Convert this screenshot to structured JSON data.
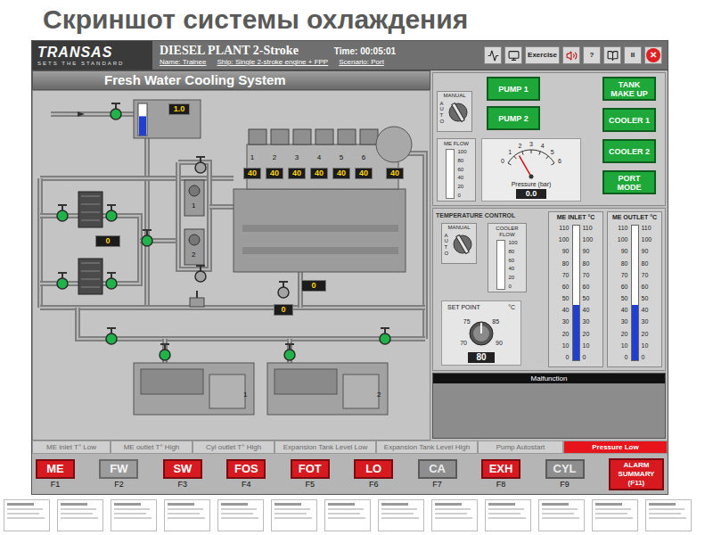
{
  "slide": {
    "title": "Скриншот системы охлаждения"
  },
  "header": {
    "logo": "TRANSAS",
    "tagline": "SETS THE STANDARD",
    "product": "DIESEL PLANT 2-Stroke",
    "time": "Time: 00:05:01",
    "name": "Name: Trainee",
    "ship": "Ship: Single 2-stroke engine + FPP",
    "scenario": "Scenario: Port",
    "toolbar": [
      {
        "kind": "chart"
      },
      {
        "kind": "screen"
      },
      {
        "kind": "text",
        "label": "Exercise"
      },
      {
        "kind": "speaker"
      },
      {
        "kind": "text",
        "label": "?"
      },
      {
        "kind": "book"
      },
      {
        "kind": "text",
        "label": "II"
      },
      {
        "kind": "close",
        "label": "✕"
      }
    ]
  },
  "panel_title": "Fresh Water Cooling System",
  "pumps": {
    "switch": {
      "top": "MANUAL",
      "side": "AUTO"
    },
    "buttons": [
      {
        "label": "PUMP 1",
        "on": true
      },
      {
        "label": "PUMP 2",
        "on": true
      }
    ]
  },
  "modes": [
    {
      "label": "TANK MAKE UP",
      "on": true
    },
    {
      "label": "COOLER 1",
      "on": true
    },
    {
      "label": "COOLER 2",
      "on": true
    },
    {
      "label": "PORT MODE",
      "on": true
    }
  ],
  "me_flow": {
    "label": "ME FLOW",
    "scale": [
      "100",
      "80",
      "60",
      "40",
      "20",
      "0"
    ],
    "level": 0
  },
  "pressure": {
    "label": "Pressure (bar)",
    "ticks": [
      "0",
      "1",
      "2",
      "3",
      "4",
      "5",
      "6"
    ],
    "level": 0.25,
    "reading": "0.0"
  },
  "temperature_control": {
    "title": "TEMPERATURE CONTROL",
    "switch": {
      "top": "MANUAL",
      "side": "AUTO"
    },
    "cooler_flow": {
      "label": "COOLER FLOW",
      "scale": [
        "100",
        "80",
        "60",
        "40",
        "20",
        "0"
      ],
      "level": 0
    },
    "set_point": {
      "label": "SET POINT",
      "unit": "°C",
      "ticks": [
        "70",
        "75",
        "85",
        "90"
      ],
      "reading": "80"
    }
  },
  "thermometers": [
    {
      "label": "ME INLET °C",
      "level": 0.41
    },
    {
      "label": "ME OUTLET °C",
      "level": 0.41
    }
  ],
  "thermo_scale": [
    "110",
    "100",
    "90",
    "80",
    "70",
    "60",
    "50",
    "40",
    "30",
    "20",
    "10",
    "0"
  ],
  "malfunction": {
    "title": "Malfunction"
  },
  "alarms": [
    {
      "label": "ME inlet T° Low",
      "active": false
    },
    {
      "label": "ME outlet T° High",
      "active": false
    },
    {
      "label": "Cyl outlet T° High",
      "active": false
    },
    {
      "label": "Expansion Tank Level Low",
      "active": false
    },
    {
      "label": "Expansion Tank Level High",
      "active": false
    },
    {
      "label": "Pump Autostart",
      "active": false
    },
    {
      "label": "Pressure Low",
      "active": true
    }
  ],
  "keys": [
    {
      "label": "ME",
      "key": "F1",
      "selected": false,
      "disabled": false
    },
    {
      "label": "FW",
      "key": "F2",
      "selected": true,
      "disabled": false
    },
    {
      "label": "SW",
      "key": "F3",
      "selected": false,
      "disabled": false
    },
    {
      "label": "FOS",
      "key": "F4",
      "selected": false,
      "disabled": false
    },
    {
      "label": "FOT",
      "key": "F5",
      "selected": false,
      "disabled": false
    },
    {
      "label": "LO",
      "key": "F6",
      "selected": false,
      "disabled": false
    },
    {
      "label": "CA",
      "key": "F7",
      "selected": false,
      "disabled": true
    },
    {
      "label": "EXH",
      "key": "F8",
      "selected": false,
      "disabled": false
    },
    {
      "label": "CYL",
      "key": "F9",
      "selected": false,
      "disabled": true
    }
  ],
  "alarm_summary": [
    "ALARM",
    "SUMMARY",
    "(F11)"
  ],
  "diagram": {
    "tank": {
      "reading": "1.0",
      "level": 0.6
    },
    "cylinders": [
      {
        "number": "1",
        "temp": "40"
      },
      {
        "number": "2",
        "temp": "40"
      },
      {
        "number": "3",
        "temp": "40"
      },
      {
        "number": "4",
        "temp": "40"
      },
      {
        "number": "5",
        "temp": "40"
      },
      {
        "number": "6",
        "temp": "40"
      }
    ],
    "turbo_temp": "40",
    "pumps": [
      "1",
      "2"
    ],
    "generators": [
      "1",
      "2"
    ],
    "readouts": [
      "0",
      "0",
      "0"
    ],
    "valves": [
      {
        "open": true
      },
      {
        "open": true
      },
      {
        "open": true
      },
      {
        "open": true
      },
      {
        "open": true
      },
      {
        "open": true
      },
      {
        "open": false
      },
      {
        "open": false
      },
      {
        "open": false
      },
      {
        "open": true
      },
      {
        "open": true
      },
      {
        "open": true
      },
      {
        "open": true
      }
    ]
  },
  "thumbnails": [
    {
      "selected": false
    },
    {
      "selected": false
    },
    {
      "selected": false
    },
    {
      "selected": false
    },
    {
      "selected": false
    },
    {
      "selected": false
    },
    {
      "selected": false
    },
    {
      "selected": false
    },
    {
      "selected": false
    },
    {
      "selected": false
    },
    {
      "selected": false
    },
    {
      "selected": false
    },
    {
      "selected": false
    }
  ]
}
